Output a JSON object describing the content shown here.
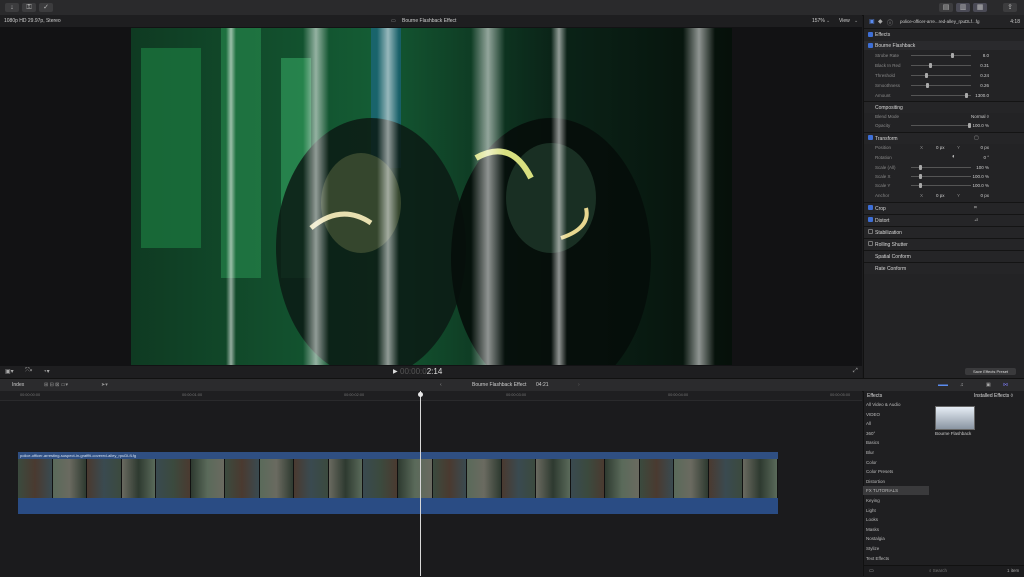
{
  "toolbar": {
    "import_icon": "download-icon",
    "keywords_icon": "key-icon",
    "bg_tasks_icon": "check-circle-icon"
  },
  "viewer": {
    "format": "1080p HD 29.97p, Stereo",
    "title": "Bourne Flashback Effect",
    "zoom": "157%",
    "view_label": "View",
    "timecode": "00:00:02:14",
    "timecode_short": "2:14"
  },
  "inspector": {
    "clip_name": "police-officer-arre...red-alley_rpuDLf...fg",
    "duration": "4:18",
    "effects_label": "Effects",
    "effect_name": "Bourne Flashback",
    "params": [
      {
        "label": "Strobe Rate",
        "value": "8.0",
        "pos": 0.7
      },
      {
        "label": "Black In Red",
        "value": "0.31",
        "pos": 0.31
      },
      {
        "label": "Threshold",
        "value": "0.24",
        "pos": 0.24
      },
      {
        "label": "Smoothness",
        "value": "0.26",
        "pos": 0.26
      },
      {
        "label": "Amount",
        "value": "1300.0",
        "pos": 0.95
      }
    ],
    "compositing_label": "Compositing",
    "blend_mode_label": "Blend Mode",
    "blend_mode_value": "Normal ◊",
    "opacity_label": "Opacity",
    "opacity_value": "100.0 %",
    "transform_label": "Transform",
    "position_label": "Position",
    "position_x": "0 px",
    "position_y": "0 px",
    "x_label": "X",
    "y_label": "Y",
    "rotation_label": "Rotation",
    "rotation_value": "0 °",
    "scale_all_label": "Scale (All)",
    "scale_all_value": "100 %",
    "scale_x_label": "Scale X",
    "scale_x_value": "100.0 %",
    "scale_y_label": "Scale Y",
    "scale_y_value": "100.0 %",
    "anchor_label": "Anchor",
    "anchor_x": "0 px",
    "anchor_y": "0 px",
    "crop_label": "Crop",
    "distort_label": "Distort",
    "stabilization_label": "Stabilization",
    "rolling_shutter_label": "Rolling Shutter",
    "spatial_conform_label": "Spatial Conform",
    "rate_conform_label": "Rate Conform",
    "save_preset": "Save Effects Preset"
  },
  "timeline": {
    "index_label": "Index",
    "project_name": "Bourne Flashback Effect",
    "project_duration": "04:21",
    "ruler_ticks": [
      "00:00:00:00",
      "00:00:01:00",
      "00:00:02:00",
      "00:00:03:00",
      "00:00:04:00",
      "00:00:05:00"
    ],
    "clip_name": "police-officer-arresting-suspect-in-graffiti-covered-alley_rpuDLfLfg"
  },
  "effects_browser": {
    "title": "Effects",
    "installed": "Installed Effects ◊",
    "categories": [
      "All Video & Audio",
      "VIDEO",
      "All",
      "360°",
      "Basics",
      "Blur",
      "Color",
      "Color Presets",
      "Distortion",
      "FX TUTORIALS",
      "Keying",
      "Light",
      "Looks",
      "Masks",
      "Nostalgia",
      "Stylize",
      "Text Effects"
    ],
    "selected": "FX TUTORIALS",
    "effect_name": "Bourne Flashback",
    "item_count": "1 item",
    "search_placeholder": "Search"
  }
}
